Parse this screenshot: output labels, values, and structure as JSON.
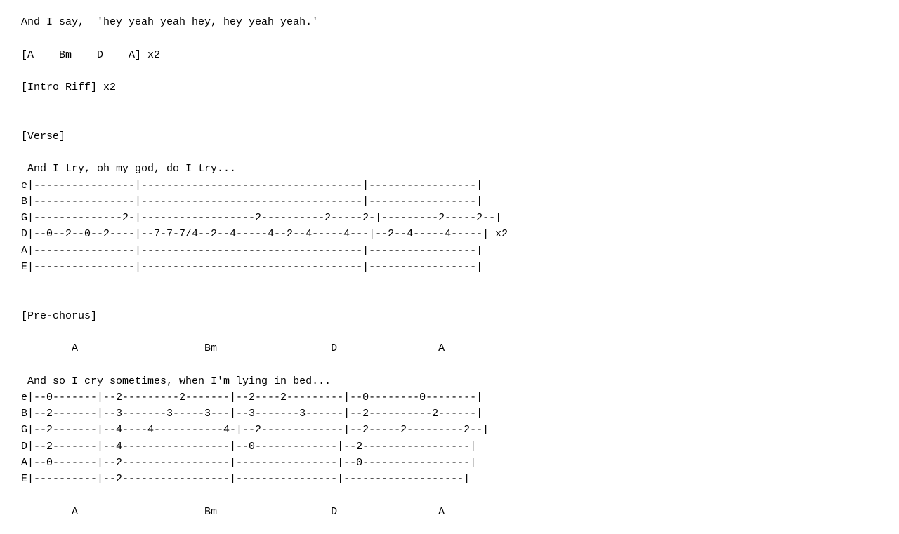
{
  "content": {
    "lines": [
      "And I say,  'hey yeah yeah hey, hey yeah yeah.'",
      "",
      "[A    Bm    D    A] x2",
      "",
      "[Intro Riff] x2",
      "",
      "",
      "[Verse]",
      "",
      " And I try, oh my god, do I try...",
      "e|----------------|-----------------------------------|-----------------|",
      "B|----------------|-----------------------------------|-----------------|",
      "G|--------------2-|------------------2----------2-----2-|---------2-----2--|",
      "D|--0--2--0--2----|--7-7-7/4--2--4-----4--2--4-----4---|--2--4-----4-----| x2",
      "A|----------------|-----------------------------------|-----------------|",
      "E|----------------|-----------------------------------|-----------------|",
      "",
      "",
      "[Pre-chorus]",
      "",
      "        A                    Bm                  D                A",
      "",
      " And so I cry sometimes, when I'm lying in bed...",
      "e|--0-------|--2---------2-------|--2----2---------|--0--------0--------|",
      "B|--2-------|--3-------3-----3---|--3-------3------|--2----------2------|",
      "G|--2-------|--4----4-----------4-|--2-------------|--2-----2---------2--|",
      "D|--2-------|--4-----------------|--0-------------|--2-----------------|",
      "A|--0-------|--2-----------------|----------------|--0-----------------|",
      "E|----------|--2-----------------|----------------|-------------------|",
      "",
      "        A                    Bm                  D                A"
    ]
  }
}
